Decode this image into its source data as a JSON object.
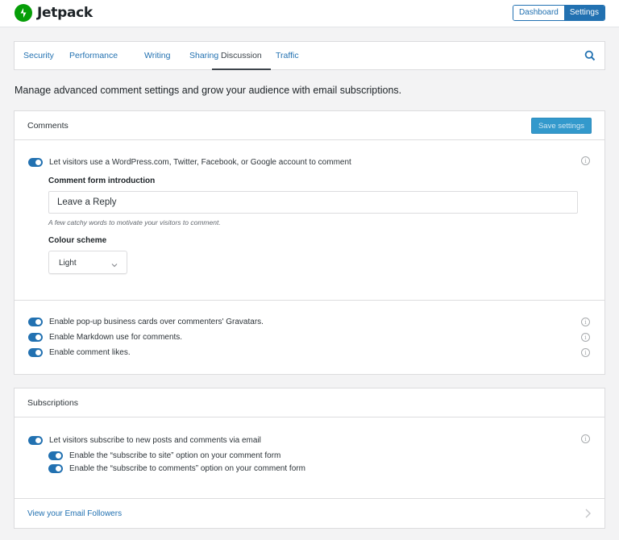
{
  "brand": {
    "name": "Jetpack",
    "color": "#069e08",
    "icon": "jetpack-bolt-icon"
  },
  "header": {
    "buttons": [
      {
        "label": "Dashboard",
        "active": false
      },
      {
        "label": "Settings",
        "active": true
      }
    ]
  },
  "tabs": [
    {
      "label": "Security"
    },
    {
      "label": "Performance"
    },
    {
      "label": "Writing"
    },
    {
      "label": "Sharing"
    },
    {
      "label": "Discussion",
      "active": true
    },
    {
      "label": "Traffic"
    }
  ],
  "search_icon": "search-icon",
  "intro": "Manage advanced comment settings and grow your audience with email subscriptions.",
  "comments": {
    "title": "Comments",
    "save_label": "Save settings",
    "social_login": {
      "label": "Let visitors use a WordPress.com, Twitter, Facebook, or Google account to comment",
      "enabled": true
    },
    "form_intro": {
      "label": "Comment form introduction",
      "value": "Leave a Reply",
      "hint": "A few catchy words to motivate your visitors to comment."
    },
    "colour_scheme": {
      "label": "Colour scheme",
      "value": "Light"
    },
    "options": [
      {
        "label": "Enable pop-up business cards over commenters' Gravatars.",
        "enabled": true
      },
      {
        "label": "Enable Markdown use for comments.",
        "enabled": true
      },
      {
        "label": "Enable comment likes.",
        "enabled": true
      }
    ]
  },
  "subscriptions": {
    "title": "Subscriptions",
    "main": {
      "label": "Let visitors subscribe to new posts and comments via email",
      "enabled": true
    },
    "sub_options": [
      {
        "label": "Enable the “subscribe to site” option on your comment form",
        "enabled": true
      },
      {
        "label": "Enable the “subscribe to comments” option on your comment form",
        "enabled": true
      }
    ],
    "followers_link": "View your Email Followers"
  },
  "colors": {
    "accent": "#2271b1",
    "save_button": "#3399cc",
    "background": "#f3f3f4"
  }
}
